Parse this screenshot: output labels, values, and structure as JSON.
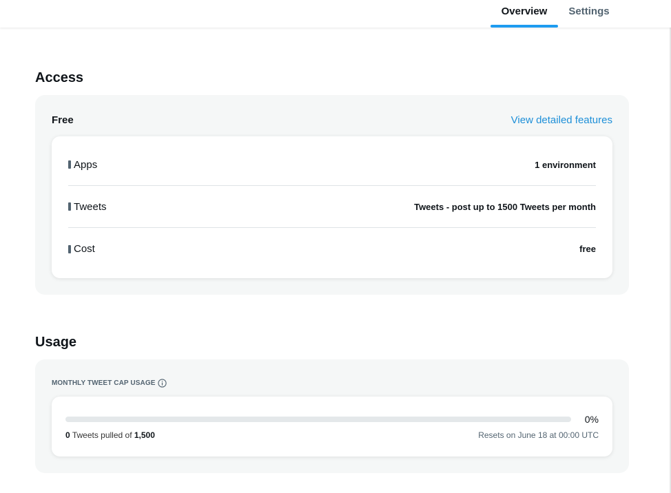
{
  "tabs": {
    "overview": "Overview",
    "settings": "Settings",
    "active": "overview"
  },
  "access": {
    "title": "Access",
    "plan_name": "Free",
    "plan_link": "View detailed features",
    "rows": [
      {
        "label": "Apps",
        "value": "1 environment"
      },
      {
        "label": "Tweets",
        "value": "Tweets - post up to 1500 Tweets per month"
      },
      {
        "label": "Cost",
        "value": "free"
      }
    ]
  },
  "usage": {
    "title": "Usage",
    "cap_header": "MONTHLY TWEET CAP USAGE",
    "progress_fraction": 0,
    "percent_text": "0%",
    "pulled": "0",
    "pulled_middle": "Tweets pulled of",
    "cap": "1,500",
    "reset_text": "Resets on June 18 at 00:00 UTC"
  },
  "colors": {
    "accent": "#1d9bf0",
    "link": "#1d8fd8",
    "panel_bg": "#f5f7f7",
    "muted_text": "#536471"
  },
  "icons": {
    "info": "info-circle-icon"
  }
}
